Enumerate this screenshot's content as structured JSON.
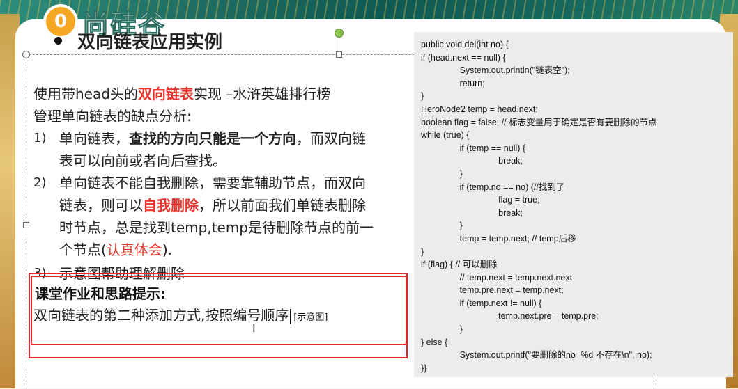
{
  "logo": {
    "mark": "0",
    "text": "尚硅谷"
  },
  "slide": {
    "title": "双向链表应用实例",
    "intro": [
      "使用带head头的",
      "双向链表",
      "实现 –水浒英雄排行榜"
    ],
    "subheading": "管理单向链表的缺点分析:",
    "items": [
      {
        "num": "1)",
        "parts": [
          "单向链表，",
          "查找的方向只能是一个方向",
          "，而双向链",
          "表可以向前或者向后查找。"
        ]
      },
      {
        "num": "2)",
        "parts": [
          "单向链表不能自我删除，需要靠辅助节点，而双向",
          "链表，则可以",
          "自我删除",
          "，所以前面我们单链表删除",
          "时节点，总是找到temp,temp是待删除节点的前一",
          "个节点(",
          "认真体会",
          ")."
        ]
      },
      {
        "num": "3)",
        "parts": [
          "示意图帮助理解删除"
        ]
      }
    ],
    "homework_title": "课堂作业和思路提示:",
    "homework_text": "双向链表的第二种添加方式,按照编号顺序",
    "homework_link": "[示意图]"
  },
  "code_lines": [
    "public void del(int no) {",
    "if (head.next == null) {",
    "                System.out.println(\"链表空\");",
    "                return;",
    "}",
    "HeroNode2 temp = head.next;",
    "boolean flag = false; // 标志变量用于确定是否有要删除的节点",
    "while (true) {",
    "                if (temp == null) {",
    "                                break;",
    "                }",
    "                if (temp.no == no) {//找到了",
    "                                flag = true;",
    "                                break;",
    "                }",
    "                temp = temp.next; // temp后移",
    "}",
    "if (flag) { // 可以删除",
    "                // temp.next = temp.next.next",
    "                temp.pre.next = temp.next;",
    "                if (temp.next != null) {",
    "                                temp.next.pre = temp.pre;",
    "                }",
    "} else {",
    "                System.out.printf(\"要删除的no=%d 不存在\\n\", no);",
    "}}"
  ],
  "colors": {
    "accent_red": "#e8342b",
    "box_red": "#e3262a",
    "code_bg": "#ececec"
  }
}
